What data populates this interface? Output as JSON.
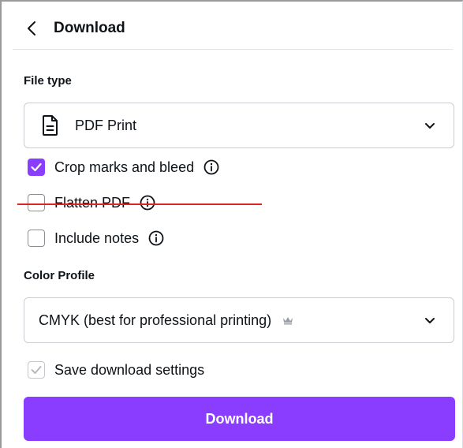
{
  "header": {
    "title": "Download",
    "back_icon": "chevron-left-icon"
  },
  "file_type": {
    "label": "File type",
    "selected": "PDF Print",
    "icon": "document-icon"
  },
  "options": [
    {
      "label": "Crop marks and bleed",
      "checked": true,
      "has_info": true
    },
    {
      "label": "Flatten PDF",
      "checked": false,
      "has_info": true,
      "struck_through": true
    },
    {
      "label": "Include notes",
      "checked": false,
      "has_info": true
    }
  ],
  "color_profile": {
    "label": "Color Profile",
    "selected": "CMYK (best for professional printing)",
    "premium_icon": "crown-icon"
  },
  "save_settings": {
    "label": "Save download settings",
    "checked": true,
    "disabled": true
  },
  "download_button": {
    "label": "Download"
  },
  "colors": {
    "accent": "#8b3dff",
    "strike": "#e02424",
    "text": "#0e1318"
  }
}
